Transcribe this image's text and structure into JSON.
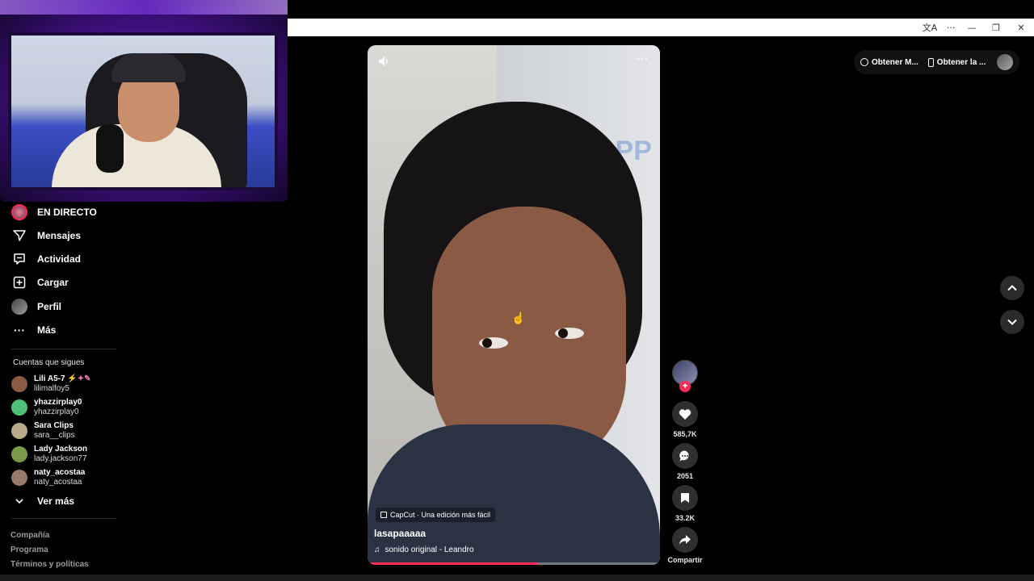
{
  "browser": {
    "controls": {
      "translate": "文A",
      "menu": "···",
      "minimize": "—",
      "restore": "❐",
      "close": "✕"
    }
  },
  "sidebar": {
    "nav": [
      {
        "label": "EN DIRECTO",
        "icon": "live-avatar-icon"
      },
      {
        "label": "Mensajes",
        "icon": "messages-icon"
      },
      {
        "label": "Actividad",
        "icon": "activity-icon"
      },
      {
        "label": "Cargar",
        "icon": "upload-icon"
      },
      {
        "label": "Perfil",
        "icon": "profile-avatar-icon"
      },
      {
        "label": "Más",
        "icon": "more-icon"
      }
    ],
    "following_title": "Cuentas que sigues",
    "following": [
      {
        "name": "Lili A5-7",
        "handle": "lilimalfoy5",
        "color": "#8a5a44"
      },
      {
        "name": "yhazzirplay0",
        "handle": "yhazzirplay0",
        "color": "#4fbf7a"
      },
      {
        "name": "Sara Clips",
        "handle": "sara__clips",
        "color": "#b8a98a"
      },
      {
        "name": "Lady Jackson",
        "handle": "lady.jackson77",
        "color": "#7a9a4a"
      },
      {
        "name": "naty_acostaa",
        "handle": "naty_acostaa",
        "color": "#9a7a6a"
      }
    ],
    "see_more": "Ver más",
    "footer": [
      "Compañía",
      "Programa",
      "Términos y políticas"
    ]
  },
  "video": {
    "capcut_badge": "CapCut · Una edición más fácil",
    "username": "lasapaaaaa",
    "sound": "sonido original - Leandro",
    "wall_text": "APP",
    "progress": 0.58
  },
  "actions": {
    "likes": "585,7K",
    "comments": "2051",
    "saves": "33.2K",
    "share": "Compartir"
  },
  "topright": {
    "get_coins": "Obtener M...",
    "get_app": "Obtener la ..."
  },
  "colors": {
    "accent": "#fe2c55",
    "background": "#000000"
  }
}
